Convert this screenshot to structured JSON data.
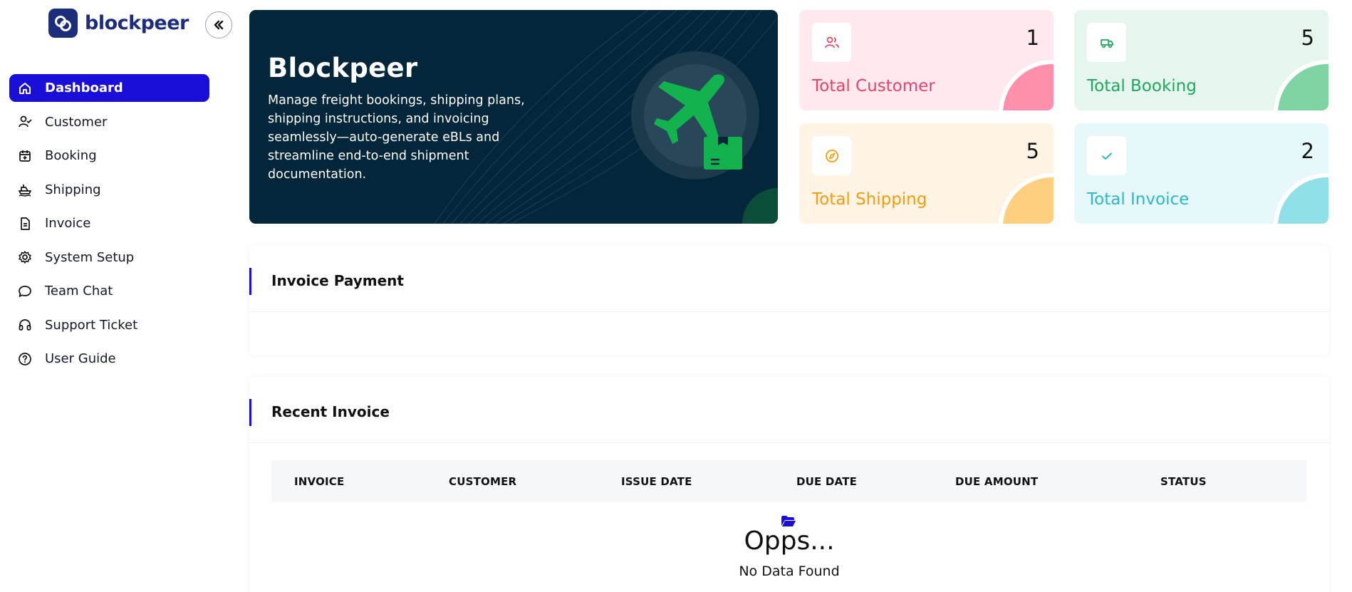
{
  "brand": {
    "name": "blockpeer"
  },
  "sidebar": {
    "items": [
      {
        "label": "Dashboard",
        "icon": "home-icon",
        "active": true
      },
      {
        "label": "Customer",
        "icon": "user-check-icon"
      },
      {
        "label": "Booking",
        "icon": "calendar-plus-icon"
      },
      {
        "label": "Shipping",
        "icon": "ship-icon"
      },
      {
        "label": "Invoice",
        "icon": "file-text-icon"
      },
      {
        "label": "System Setup",
        "icon": "gear-icon"
      },
      {
        "label": "Team Chat",
        "icon": "chat-bubble-icon"
      },
      {
        "label": "Support Ticket",
        "icon": "headphones-icon"
      },
      {
        "label": "User Guide",
        "icon": "help-circle-icon"
      }
    ]
  },
  "hero": {
    "title": "Blockpeer",
    "description": "Manage freight bookings, shipping plans, shipping instructions, and invoicing seamlessly—auto-generate eBLs and streamline end-to-end shipment documentation."
  },
  "stats": [
    {
      "label": "Total Customer",
      "value": "1",
      "icon": "users-icon",
      "color": "#e8436b",
      "bg": "#ffe9ee",
      "blob": "#ff8faa"
    },
    {
      "label": "Total Booking",
      "value": "5",
      "icon": "truck-icon",
      "color": "#1ea85f",
      "bg": "#e6f6ee",
      "blob": "#7fd4a3"
    },
    {
      "label": "Total Shipping",
      "value": "5",
      "icon": "compass-icon",
      "color": "#f39c12",
      "bg": "#fff4e4",
      "blob": "#ffcf80"
    },
    {
      "label": "Total Invoice",
      "value": "2",
      "icon": "check-icon",
      "color": "#2bb8c8",
      "bg": "#e6f8f9",
      "blob": "#8fdfe6"
    }
  ],
  "invoice_payment": {
    "title": "Invoice Payment"
  },
  "recent_invoice": {
    "title": "Recent Invoice",
    "columns": [
      "INVOICE",
      "CUSTOMER",
      "ISSUE DATE",
      "DUE DATE",
      "DUE AMOUNT",
      "STATUS"
    ],
    "empty_title": "Opps...",
    "empty_subtitle": "No Data Found"
  }
}
